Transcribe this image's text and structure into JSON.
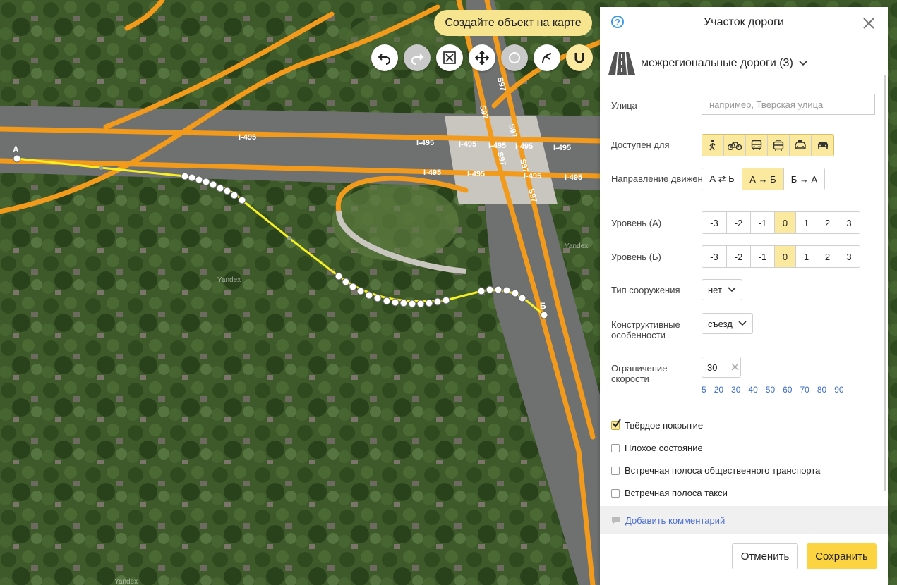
{
  "map": {
    "create_object_label": "Создайте объект на карте",
    "highway_labels": [
      "I-495",
      "I-495",
      "I-495",
      "I-495",
      "I-495",
      "I-495",
      "I-495",
      "I-495",
      "I-495",
      "I-495"
    ],
    "route_labels": [
      "S97",
      "S97",
      "S97",
      "S97",
      "S97",
      "S97"
    ],
    "point_a": "А",
    "point_b": "Б",
    "watermark": "Yandex",
    "tools": [
      {
        "name": "undo-icon",
        "state": "enabled"
      },
      {
        "name": "redo-icon",
        "state": "disabled"
      },
      {
        "name": "fit-view-icon",
        "state": "enabled"
      },
      {
        "name": "move-icon",
        "state": "enabled"
      },
      {
        "name": "circle-icon",
        "state": "disabled"
      },
      {
        "name": "split-road-icon",
        "state": "enabled"
      },
      {
        "name": "magnet-icon",
        "state": "active"
      }
    ]
  },
  "panel": {
    "title": "Участок дороги",
    "road_category": "межрегиональные дороги (3)",
    "street": {
      "label": "Улица",
      "placeholder": "например, Тверская улица",
      "value": ""
    },
    "access": {
      "label": "Доступен для",
      "modes": [
        {
          "name": "pedestrian-icon",
          "on": true
        },
        {
          "name": "bicycle-icon",
          "on": true
        },
        {
          "name": "bus-icon",
          "on": true
        },
        {
          "name": "trolleybus-icon",
          "on": true
        },
        {
          "name": "taxi-icon",
          "on": true
        },
        {
          "name": "car-icon",
          "on": true
        }
      ]
    },
    "direction": {
      "label": "Направление движения",
      "options": [
        "А ⇄ Б",
        "А → Б",
        "Б → А"
      ],
      "selected": 1
    },
    "level_a": {
      "label": "Уровень (А)",
      "options": [
        "-3",
        "-2",
        "-1",
        "0",
        "1",
        "2",
        "3"
      ],
      "selected": 3
    },
    "level_b": {
      "label": "Уровень (Б)",
      "options": [
        "-3",
        "-2",
        "-1",
        "0",
        "1",
        "2",
        "3"
      ],
      "selected": 3
    },
    "structure_type": {
      "label": "Тип сооружения",
      "value": "нет"
    },
    "construction": {
      "label": "Конструктивные особенности",
      "value": "съезд"
    },
    "speed_limit": {
      "label": "Ограничение скорости",
      "value": "30",
      "presets": [
        "5",
        "20",
        "30",
        "40",
        "50",
        "60",
        "70",
        "80",
        "90"
      ]
    },
    "checkboxes": [
      {
        "label": "Твёрдое покрытие",
        "checked": true
      },
      {
        "label": "Плохое состояние",
        "checked": false
      },
      {
        "label": "Встречная полоса общественного транспорта",
        "checked": false
      },
      {
        "label": "Встречная полоса такси",
        "checked": false
      }
    ],
    "add_comment": "Добавить комментарий",
    "cancel_label": "Отменить",
    "save_label": "Сохранить",
    "colors": {
      "accent": "#fcd340",
      "selected": "#fbe9a0",
      "link": "#4b6ed1",
      "help": "#3c9be4"
    }
  }
}
